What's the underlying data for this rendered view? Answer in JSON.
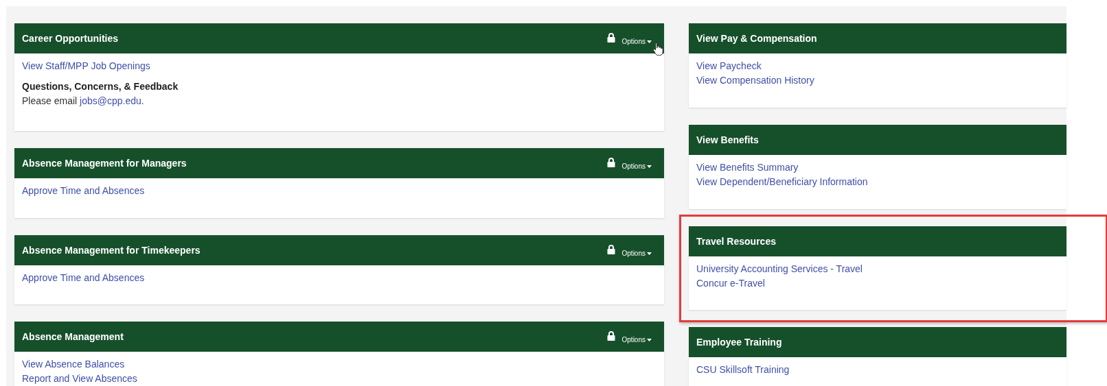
{
  "columns": [
    {
      "cards": [
        {
          "title": "Career Opportunities",
          "locked": true,
          "options": {
            "label": "Options",
            "hovered": true
          },
          "highlighted": false,
          "items": [
            {
              "kind": "link",
              "text": "View Staff/MPP Job Openings"
            },
            {
              "kind": "heading",
              "text": "Questions, Concerns, & Feedback"
            },
            {
              "kind": "text",
              "text": "Please email ",
              "link": "jobs@cpp.edu",
              "suffix": "."
            }
          ]
        },
        {
          "title": "Absence Management for Managers",
          "locked": true,
          "options": {
            "label": "Options",
            "hovered": false
          },
          "highlighted": false,
          "items": [
            {
              "kind": "link",
              "text": "Approve Time and Absences"
            }
          ]
        },
        {
          "title": "Absence Management for Timekeepers",
          "locked": true,
          "options": {
            "label": "Options",
            "hovered": false
          },
          "highlighted": false,
          "items": [
            {
              "kind": "link",
              "text": "Approve Time and Absences"
            }
          ]
        },
        {
          "title": "Absence Management",
          "locked": true,
          "options": {
            "label": "Options",
            "hovered": false
          },
          "highlighted": false,
          "items": [
            {
              "kind": "link",
              "text": "View Absence Balances"
            },
            {
              "kind": "link",
              "text": "Report and View Absences"
            }
          ]
        }
      ]
    },
    {
      "cards": [
        {
          "title": "View Pay & Compensation",
          "locked": false,
          "highlighted": false,
          "items": [
            {
              "kind": "link",
              "text": "View Paycheck"
            },
            {
              "kind": "link",
              "text": "View Compensation History"
            }
          ]
        },
        {
          "title": "View Benefits",
          "locked": false,
          "highlighted": false,
          "items": [
            {
              "kind": "link",
              "text": "View Benefits Summary"
            },
            {
              "kind": "link",
              "text": "View Dependent/Beneficiary Information"
            }
          ]
        },
        {
          "title": "Travel Resources",
          "locked": false,
          "highlighted": true,
          "items": [
            {
              "kind": "link",
              "text": "University Accounting Services - Travel"
            },
            {
              "kind": "link",
              "text": "Concur e-Travel"
            }
          ]
        },
        {
          "title": "Employee Training",
          "locked": false,
          "highlighted": false,
          "items": [
            {
              "kind": "link",
              "text": "CSU Skillsoft Training"
            }
          ]
        }
      ]
    }
  ]
}
